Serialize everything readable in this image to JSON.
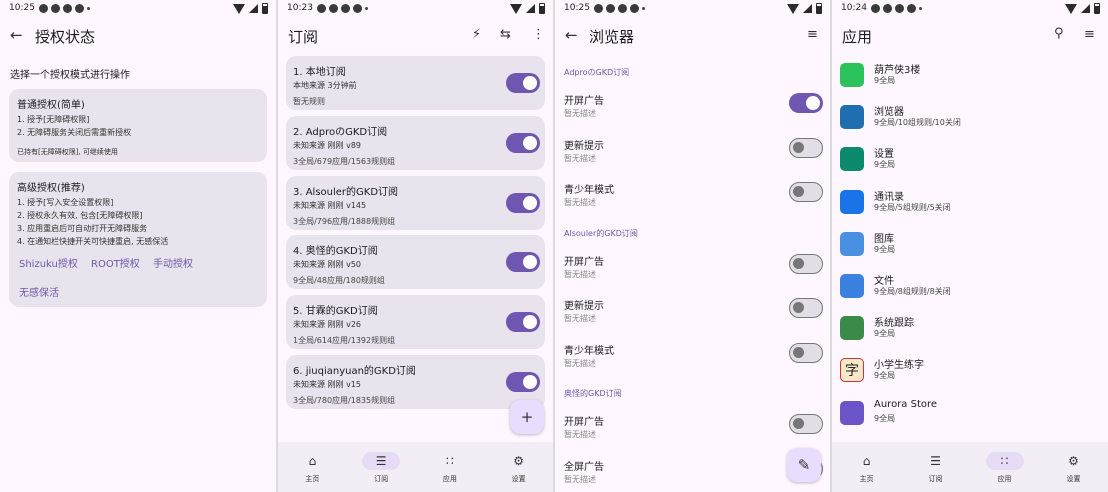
{
  "p1": {
    "time": "10:25",
    "title": "授权状态",
    "subtitle": "选择一个授权模式进行操作",
    "normal": {
      "title": "普通授权(简单)",
      "l1": "1. 授予[无障碍权限]",
      "l2": "2. 无障碍服务关闭后需重新授权",
      "note": "已持有[无障碍权限], 可继续使用"
    },
    "adv": {
      "title": "高级授权(推荐)",
      "l1": "1. 授予[写入安全设置权限]",
      "l2": "2. 授权永久有效, 包含[无障碍权限]",
      "l3": "3. 应用重启后可自动打开无障碍服务",
      "l4": "4. 在通知栏快捷开关可快捷重启, 无感保活",
      "b1": "Shizuku授权",
      "b2": "ROOT授权",
      "b3": "手动授权",
      "b4": "无感保活"
    }
  },
  "p2": {
    "time": "10:23",
    "title": "订阅",
    "items": [
      {
        "name": "1. 本地订阅",
        "l2": "本地来源   3分钟前",
        "l3": "暂无规则",
        "on": true
      },
      {
        "name": "2. AdproのGKD订阅",
        "l2": "未知来源   刚刚   v89",
        "l3": "3全局/679应用/1563规则组",
        "on": true
      },
      {
        "name": "3. Alsouler的GKD订阅",
        "l2": "未知来源   刚刚   v145",
        "l3": "3全局/796应用/1888规则组",
        "on": true
      },
      {
        "name": "4. 奥怪的GKD订阅",
        "l2": "未知来源   刚刚   v50",
        "l3": "9全局/48应用/180规则组",
        "on": true
      },
      {
        "name": "5. 甘霖的GKD订阅",
        "l2": "未知来源   刚刚   v26",
        "l3": "1全局/614应用/1392规则组",
        "on": true
      },
      {
        "name": "6. jiuqianyuan的GKD订阅",
        "l2": "未知来源   刚刚   v15",
        "l3": "3全局/780应用/1835规则组",
        "on": true
      }
    ],
    "fab": "+"
  },
  "p3": {
    "time": "10:25",
    "title": "浏览器",
    "groups": [
      {
        "name": "AdproのGKD订阅",
        "rules": [
          {
            "t": "开屏广告",
            "s": "暂无描述",
            "on": true
          },
          {
            "t": "更新提示",
            "s": "暂无描述",
            "on": false
          },
          {
            "t": "青少年模式",
            "s": "暂无描述",
            "on": false
          }
        ]
      },
      {
        "name": "Alsouler的GKD订阅",
        "rules": [
          {
            "t": "开屏广告",
            "s": "暂无描述",
            "on": false
          },
          {
            "t": "更新提示",
            "s": "暂无描述",
            "on": false
          },
          {
            "t": "青少年模式",
            "s": "暂无描述",
            "on": false
          }
        ]
      },
      {
        "name": "奥怪的GKD订阅",
        "rules": [
          {
            "t": "开屏广告",
            "s": "暂无描述",
            "on": false
          },
          {
            "t": "全屏广告",
            "s": "暂无描述",
            "on": false
          }
        ]
      }
    ]
  },
  "p4": {
    "time": "10:24",
    "title": "应用",
    "apps": [
      {
        "name": "葫芦侠3楼",
        "desc": "9全局",
        "color": "#2bc25c",
        "icon": "chat-bubble-icon"
      },
      {
        "name": "浏览器",
        "desc": "9全局/10组规则/10关闭",
        "color": "#1f6fb0",
        "icon": "globe-icon"
      },
      {
        "name": "设置",
        "desc": "9全局",
        "color": "#0d8a6e",
        "icon": "gear-icon"
      },
      {
        "name": "通讯录",
        "desc": "9全局/5组规则/5关闭",
        "color": "#1a73e8",
        "icon": "contact-icon"
      },
      {
        "name": "图库",
        "desc": "9全局",
        "color": "#4a90e2",
        "icon": "image-icon"
      },
      {
        "name": "文件",
        "desc": "9全局/8组规则/8关闭",
        "color": "#3b82e0",
        "icon": "folder-icon"
      },
      {
        "name": "系统跟踪",
        "desc": "9全局",
        "color": "#3a8a4a",
        "icon": "android-icon"
      },
      {
        "name": "小学生练字",
        "desc": "9全局",
        "color": "#f6e8c8",
        "icon": "character-icon",
        "glyph": "字"
      },
      {
        "name": "Aurora Store",
        "desc": "9全局",
        "color": "#6a54c8",
        "icon": "store-bag-icon"
      }
    ]
  },
  "nav": {
    "home": "主页",
    "subs": "订阅",
    "apps": "应用",
    "settings": "设置"
  }
}
